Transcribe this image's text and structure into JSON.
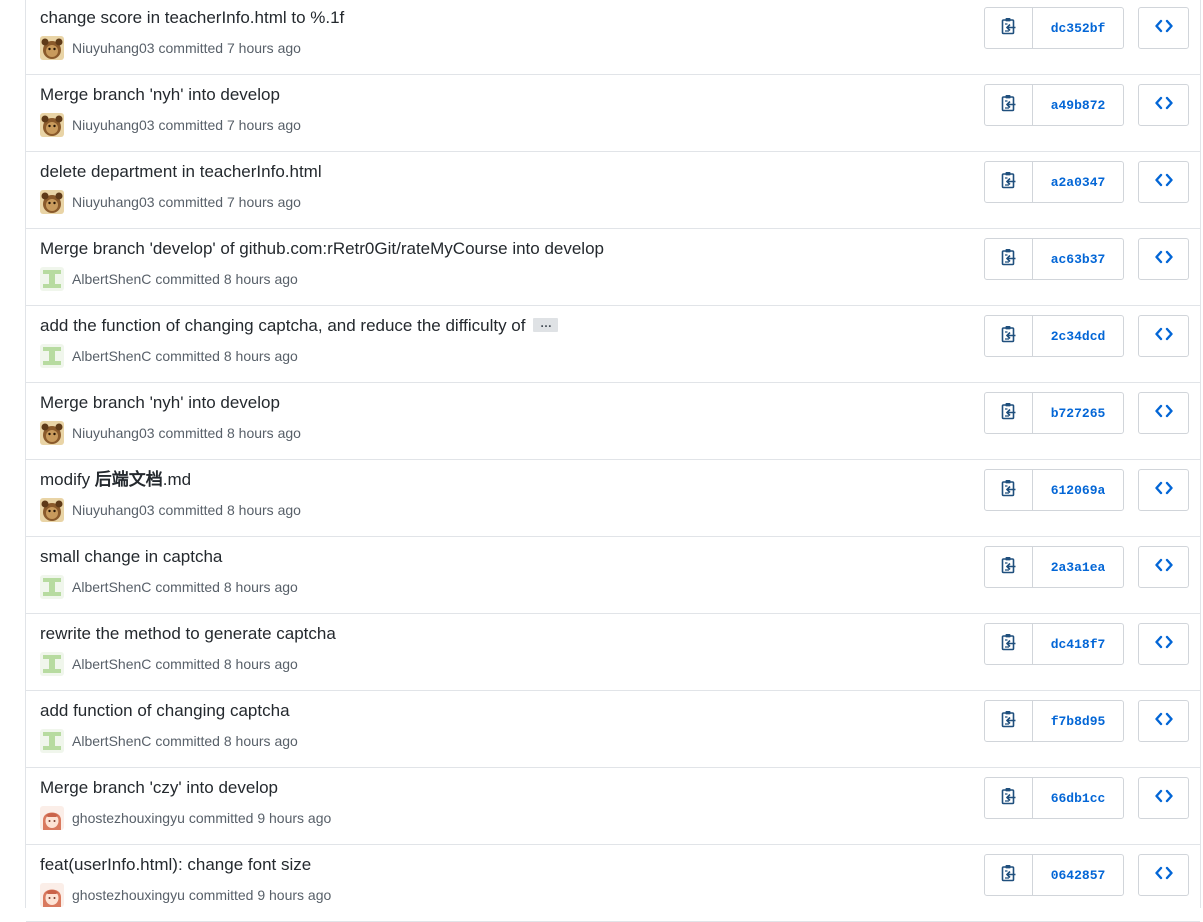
{
  "commits": [
    {
      "message": "change score in teacherInfo.html to %.1f",
      "author": "Niuyuhang03",
      "avatar": "niuyuhang-avatar",
      "when": "committed 7 hours ago",
      "sha": "dc352bf",
      "truncated": false
    },
    {
      "message": "Merge branch 'nyh' into develop",
      "author": "Niuyuhang03",
      "avatar": "niuyuhang-avatar",
      "when": "committed 7 hours ago",
      "sha": "a49b872",
      "truncated": false
    },
    {
      "message": "delete department in teacherInfo.html",
      "author": "Niuyuhang03",
      "avatar": "niuyuhang-avatar",
      "when": "committed 7 hours ago",
      "sha": "a2a0347",
      "truncated": false
    },
    {
      "message": "Merge branch 'develop' of github.com:rRetr0Git/rateMyCourse into develop",
      "author": "AlbertShenC",
      "avatar": "albertshenc-avatar",
      "when": "committed 8 hours ago",
      "sha": "ac63b37",
      "truncated": false
    },
    {
      "message": "add the function of changing captcha, and reduce the difficulty of",
      "author": "AlbertShenC",
      "avatar": "albertshenc-avatar",
      "when": "committed 8 hours ago",
      "sha": "2c34dcd",
      "truncated": true
    },
    {
      "message": "Merge branch 'nyh' into develop",
      "author": "Niuyuhang03",
      "avatar": "niuyuhang-avatar",
      "when": "committed 8 hours ago",
      "sha": "b727265",
      "truncated": false
    },
    {
      "message_prefix": "modify ",
      "message_bold": "后端文档",
      "message_suffix": ".md",
      "author": "Niuyuhang03",
      "avatar": "niuyuhang-avatar",
      "when": "committed 8 hours ago",
      "sha": "612069a",
      "truncated": false
    },
    {
      "message": "small change in captcha",
      "author": "AlbertShenC",
      "avatar": "albertshenc-avatar",
      "when": "committed 8 hours ago",
      "sha": "2a3a1ea",
      "truncated": false
    },
    {
      "message": "rewrite the method to generate captcha",
      "author": "AlbertShenC",
      "avatar": "albertshenc-avatar",
      "when": "committed 8 hours ago",
      "sha": "dc418f7",
      "truncated": false
    },
    {
      "message": "add function of changing captcha",
      "author": "AlbertShenC",
      "avatar": "albertshenc-avatar",
      "when": "committed 8 hours ago",
      "sha": "f7b8d95",
      "truncated": false
    },
    {
      "message": "Merge branch 'czy' into develop",
      "author": "ghostezhouxingyu",
      "avatar": "ghostezhouxingyu-avatar",
      "when": "committed 9 hours ago",
      "sha": "66db1cc",
      "truncated": false
    },
    {
      "message": "feat(userInfo.html): change font size",
      "author": "ghostezhouxingyu",
      "avatar": "ghostezhouxingyu-avatar",
      "when": "committed 9 hours ago",
      "sha": "0642857",
      "truncated": false
    }
  ],
  "ui": {
    "ellipsis_label": "…",
    "copy_icon": "clipboard-icon",
    "browse_icon": "code-icon",
    "link_color": "#0366d6",
    "border_color": "#e1e4e8"
  }
}
